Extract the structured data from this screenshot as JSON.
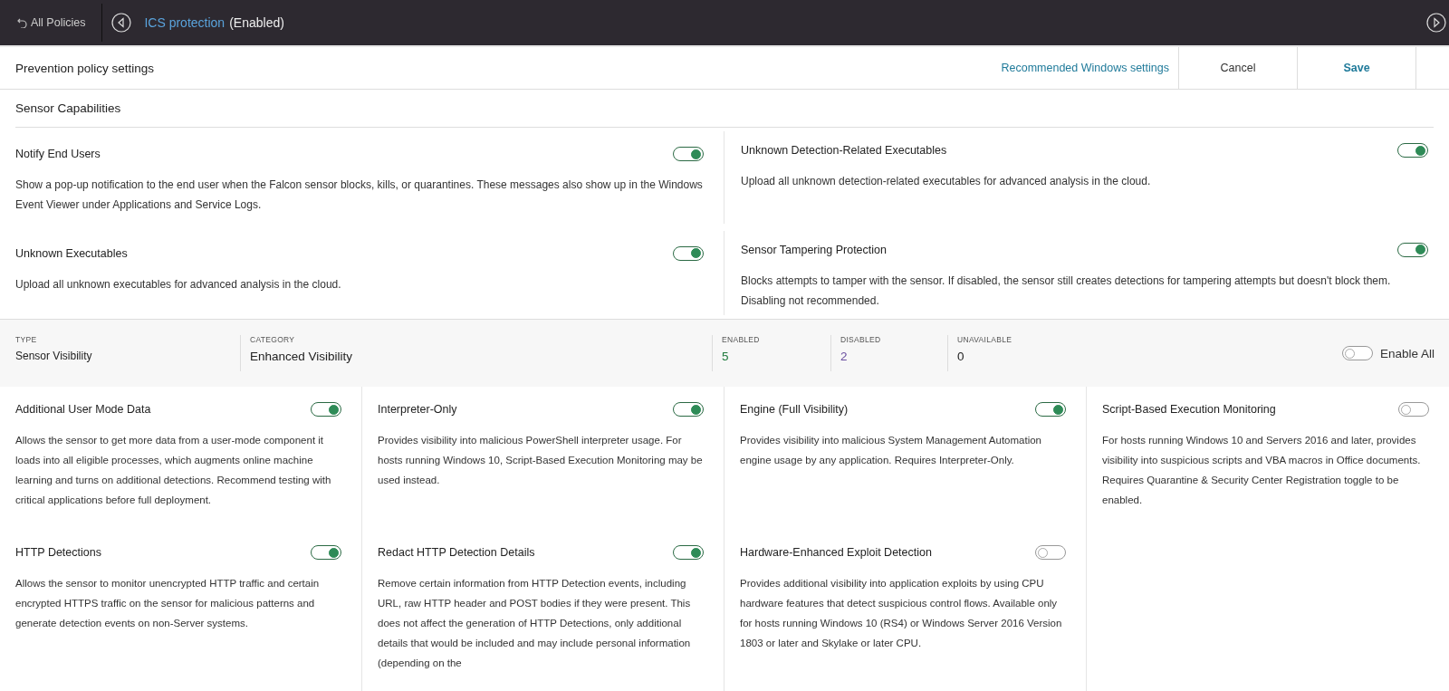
{
  "topbar": {
    "back_label": "All Policies",
    "policy_name": "ICS protection",
    "policy_status": "(Enabled)"
  },
  "header": {
    "title": "Prevention policy settings",
    "recommended_link": "Recommended Windows settings",
    "buttons": [
      {
        "label": "Cancel",
        "kind": "secondary"
      },
      {
        "label": "Save",
        "kind": "primary"
      }
    ]
  },
  "section_title": "Sensor Capabilities",
  "capabilities": [
    {
      "title": "Notify End Users",
      "description": "Show a pop-up notification to the end user when the Falcon sensor blocks, kills, or quarantines. These messages also show up in the Windows Event Viewer under Applications and Service Logs.",
      "on": true
    },
    {
      "title": "Unknown Detection-Related Executables",
      "description": "Upload all unknown detection-related executables for advanced analysis in the cloud.",
      "on": true
    },
    {
      "title": "Unknown Executables",
      "description": "Upload all unknown executables for advanced analysis in the cloud.",
      "on": true
    },
    {
      "title": "Sensor Tampering Protection",
      "description": "Blocks attempts to tamper with the sensor. If disabled, the sensor still creates detections for tampering attempts but doesn't block them. Disabling not recommended.",
      "on": true
    }
  ],
  "summary": [
    {
      "label": "TYPE",
      "value": "Sensor Visibility",
      "kind": "plain"
    },
    {
      "label": "CATEGORY",
      "value": "Enhanced Visibility",
      "kind": "large"
    },
    {
      "label": "ENABLED",
      "value": "5",
      "kind": "enabled"
    },
    {
      "label": "DISABLED",
      "value": "2",
      "kind": "disabled"
    },
    {
      "label": "UNAVAILABLE",
      "value": "0",
      "kind": "large"
    }
  ],
  "enable_all": {
    "label": "Enable All",
    "on": false
  },
  "settings": [
    {
      "title": "Additional User Mode Data",
      "description": "Allows the sensor to get more data from a user-mode component it loads into all eligible processes, which augments online machine learning and turns on additional detections. Recommend testing with critical applications before full deployment.",
      "on": true
    },
    {
      "title": "Interpreter-Only",
      "description": "Provides visibility into malicious PowerShell interpreter usage. For hosts running Windows 10, Script-Based Execution Monitoring may be used instead.",
      "on": true
    },
    {
      "title": "Engine (Full Visibility)",
      "description": "Provides visibility into malicious System Management Automation engine usage by any application. Requires Interpreter-Only.",
      "on": true
    },
    {
      "title": "Script-Based Execution Monitoring",
      "description": "For hosts running Windows 10 and Servers 2016 and later, provides visibility into suspicious scripts and VBA macros in Office documents. Requires Quarantine & Security Center Registration toggle to be enabled.",
      "on": false
    },
    {
      "title": "HTTP Detections",
      "description": "Allows the sensor to monitor unencrypted HTTP traffic and certain encrypted HTTPS traffic on the sensor for malicious patterns and generate detection events on non-Server systems.",
      "on": true
    },
    {
      "title": "Redact HTTP Detection Details",
      "description": "Remove certain information from HTTP Detection events, including URL, raw HTTP header and POST bodies if they were present. This does not affect the generation of HTTP Detections, only additional details that would be included and may include personal information (depending on the",
      "on": true
    },
    {
      "title": "Hardware-Enhanced Exploit Detection",
      "description": "Provides additional visibility into application exploits by using CPU hardware features that detect suspicious control flows. Available only for hosts running Windows 10 (RS4) or Windows Server 2016 Version 1803 or later and Skylake or later CPU.",
      "on": false
    }
  ]
}
